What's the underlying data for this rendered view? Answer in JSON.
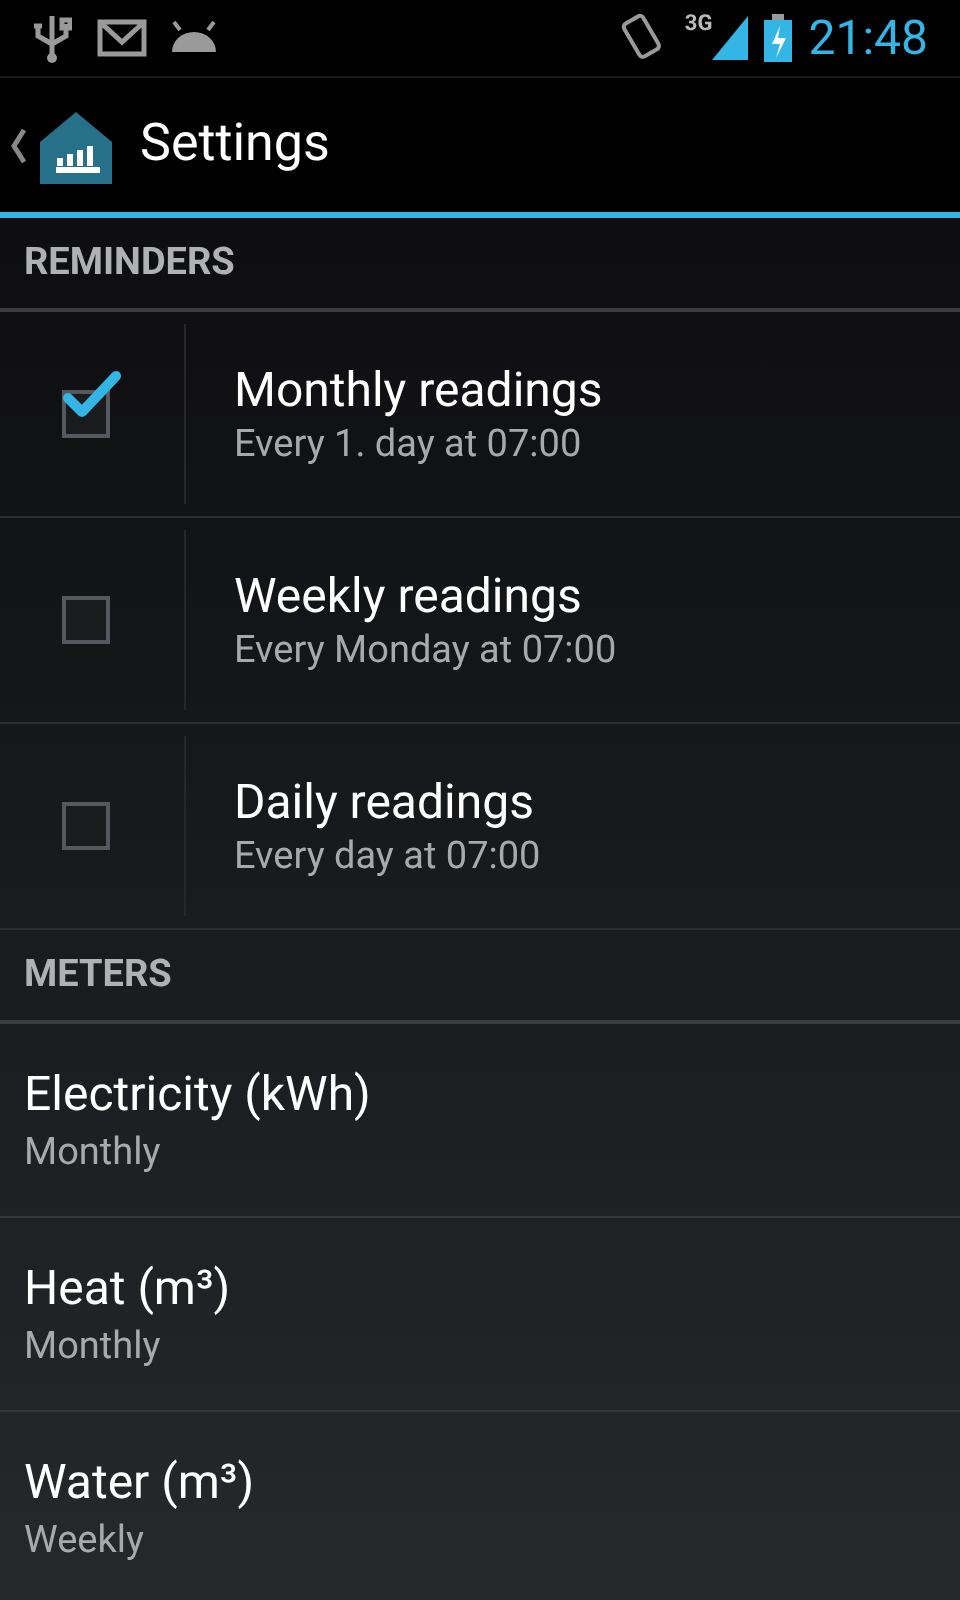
{
  "status_bar": {
    "network": "3G",
    "time": "21:48"
  },
  "action_bar": {
    "title": "Settings"
  },
  "sections": [
    {
      "title": "REMINDERS",
      "items": [
        {
          "kind": "checkbox",
          "title": "Monthly readings",
          "summary": "Every 1. day at 07:00",
          "checked": true
        },
        {
          "kind": "checkbox",
          "title": "Weekly readings",
          "summary": "Every Monday at 07:00",
          "checked": false
        },
        {
          "kind": "checkbox",
          "title": "Daily readings",
          "summary": "Every day at 07:00",
          "checked": false
        }
      ]
    },
    {
      "title": "METERS",
      "items": [
        {
          "kind": "plain",
          "title": "Electricity (kWh)",
          "summary": "Monthly"
        },
        {
          "kind": "plain",
          "title": "Heat (m³)",
          "summary": "Monthly"
        },
        {
          "kind": "plain",
          "title": "Water (m³)",
          "summary": "Weekly"
        }
      ]
    }
  ]
}
